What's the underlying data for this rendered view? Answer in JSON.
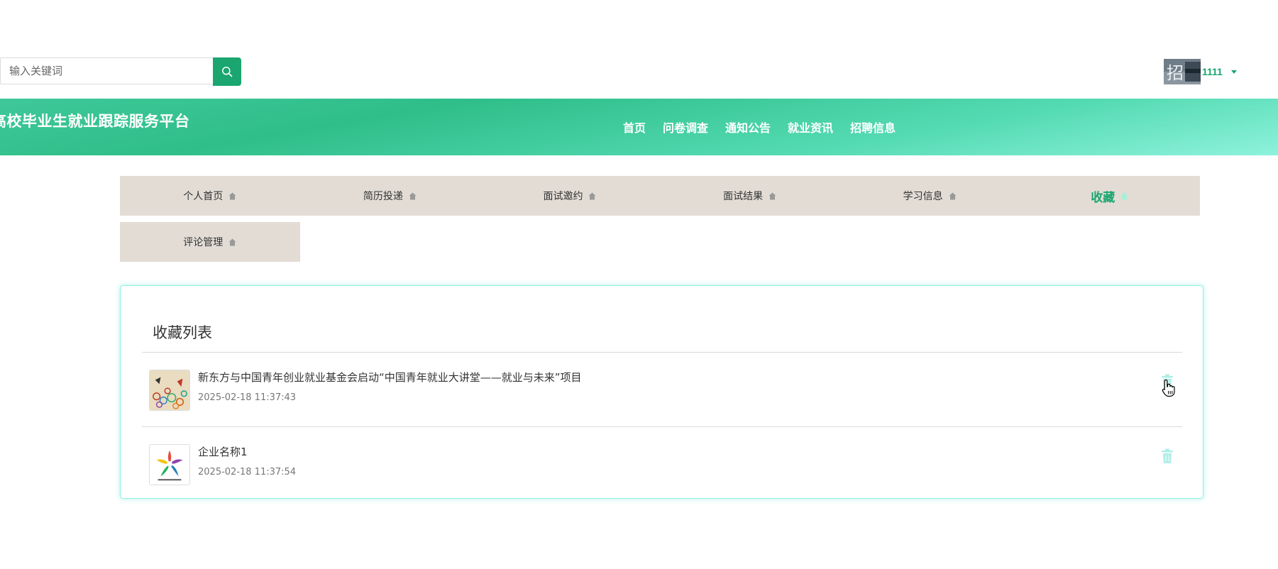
{
  "search": {
    "placeholder": "输入关键词",
    "button_icon": "search-icon"
  },
  "user": {
    "name": "1111",
    "avatar_icon": "avatar-image",
    "menu_icon": "caret-down-icon"
  },
  "header": {
    "site_title": "高校毕业生就业跟踪服务平台",
    "nav": [
      "首页",
      "问卷调查",
      "通知公告",
      "就业资讯",
      "招聘信息"
    ]
  },
  "tabs": [
    {
      "label": "个人首页",
      "icon": "home-icon",
      "active": false
    },
    {
      "label": "简历投递",
      "icon": "home-icon",
      "active": false
    },
    {
      "label": "面试邀约",
      "icon": "home-icon",
      "active": false
    },
    {
      "label": "面试结果",
      "icon": "home-icon",
      "active": false
    },
    {
      "label": "学习信息",
      "icon": "home-icon",
      "active": false
    },
    {
      "label": "收藏",
      "icon": "home-icon",
      "active": true
    },
    {
      "label": "评论管理",
      "icon": "home-icon",
      "active": false
    }
  ],
  "favorites": {
    "title": "收藏列表",
    "items": [
      {
        "title": "新东方与中国青年创业就业基金会启动“中国青年就业大讲堂——就业与未来”项目",
        "date": "2025-02-18 11:37:43",
        "delete_icon": "trash-icon"
      },
      {
        "title": "企业名称1",
        "date": "2025-02-18 11:37:54",
        "delete_icon": "trash-icon"
      }
    ]
  },
  "colors": {
    "accent": "#1aa66e",
    "tab_bg": "#e2dcd5",
    "panel_border": "#8ff0e0",
    "trash": "#aeeee6"
  }
}
